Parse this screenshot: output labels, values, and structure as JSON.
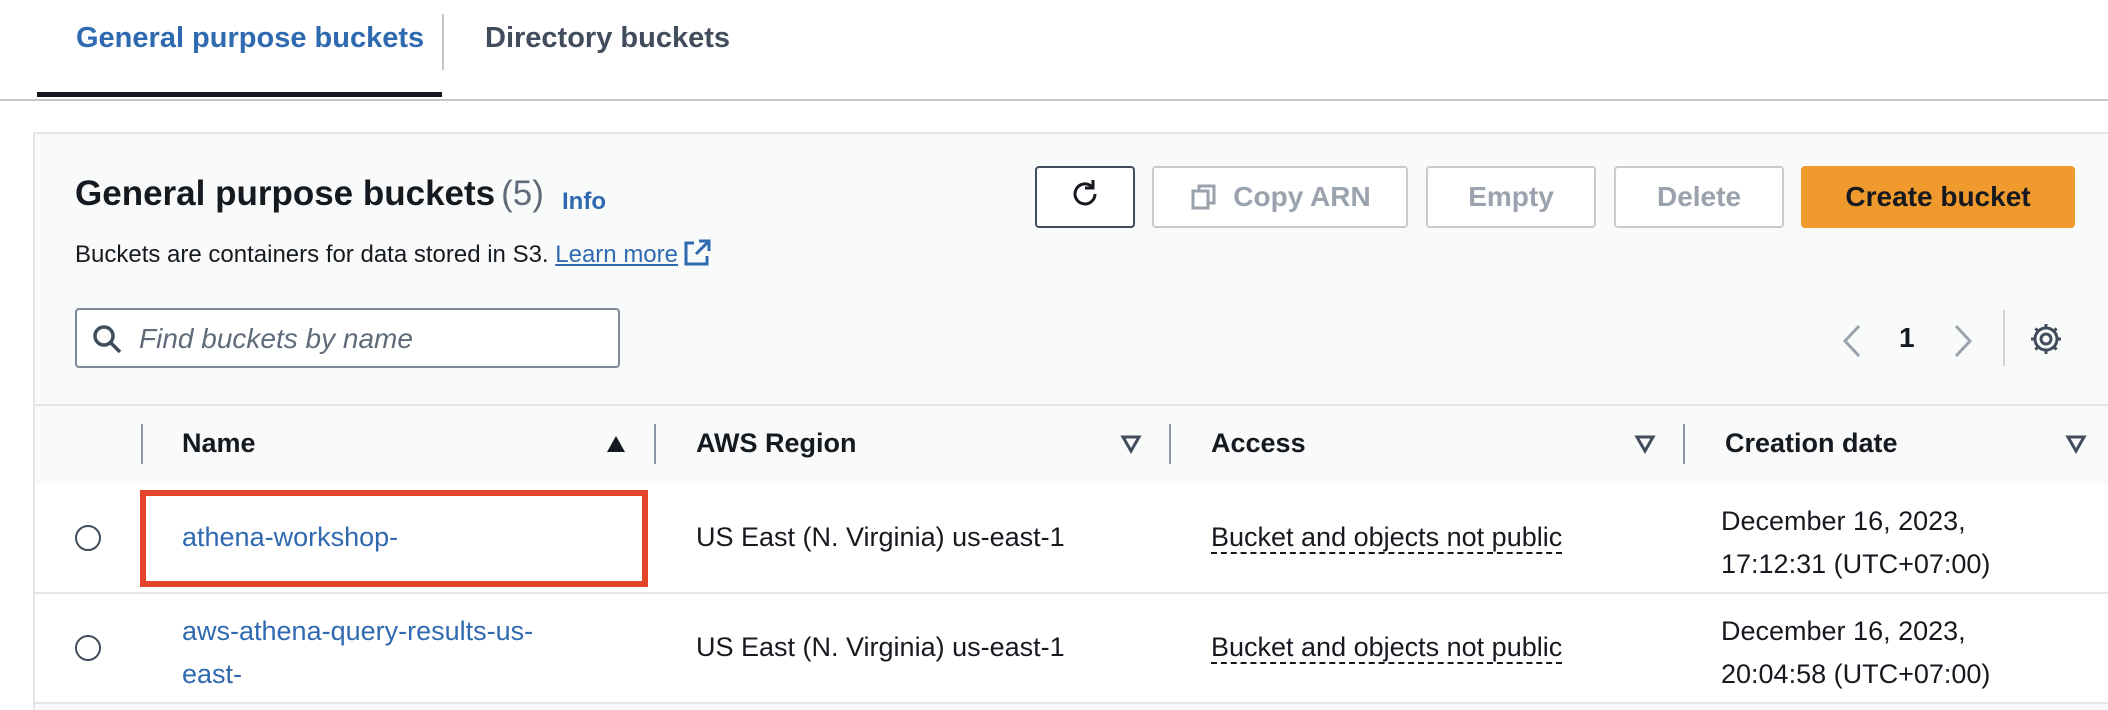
{
  "tabs": {
    "general": "General purpose buckets",
    "directory": "Directory buckets"
  },
  "header": {
    "title": "General purpose buckets",
    "count": "(5)",
    "info": "Info",
    "description": "Buckets are containers for data stored in S3.",
    "learn_more": "Learn more"
  },
  "toolbar": {
    "copy_arn": "Copy ARN",
    "empty": "Empty",
    "delete": "Delete",
    "create_bucket": "Create bucket"
  },
  "search": {
    "placeholder": "Find buckets by name",
    "value": ""
  },
  "pagination": {
    "current_page": "1"
  },
  "table": {
    "columns": [
      "Name",
      "AWS Region",
      "Access",
      "Creation date"
    ],
    "rows": [
      {
        "name_line1": "athena-workshop-",
        "name_line2": "",
        "region": "US East (N. Virginia) us-east-1",
        "access": "Bucket and objects not public",
        "date_line1": "December 16, 2023,",
        "date_line2": "17:12:31 (UTC+07:00)"
      },
      {
        "name_line1": "aws-athena-query-results-us-",
        "name_line2": "east-",
        "region": "US East (N. Virginia) us-east-1",
        "access": "Bucket and objects not public",
        "date_line1": "December 16, 2023,",
        "date_line2": "20:04:58 (UTC+07:00)"
      }
    ]
  },
  "colors": {
    "accent_link": "#2f6ab0",
    "primary_button": "#f09a2e",
    "highlight": "#e4442b"
  },
  "icons": [
    "refresh-icon",
    "copy-icon",
    "external-link-icon",
    "search-icon",
    "chevron-left-icon",
    "chevron-right-icon",
    "gear-icon",
    "sort-ascending-icon",
    "sort-icon"
  ]
}
